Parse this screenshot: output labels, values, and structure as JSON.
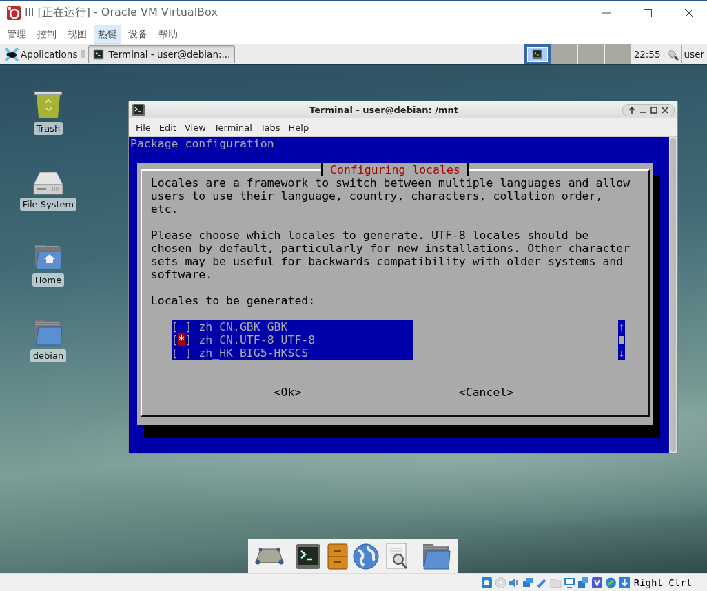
{
  "vbox_window": {
    "title": "lll [正在运行] - Oracle VM VirtualBox"
  },
  "vbox_menu": [
    {
      "label": "管理",
      "selected": false
    },
    {
      "label": "控制",
      "selected": false
    },
    {
      "label": "视图",
      "selected": false
    },
    {
      "label": "热键",
      "selected": true
    },
    {
      "label": "设备",
      "selected": false
    },
    {
      "label": "帮助",
      "selected": false
    }
  ],
  "panel": {
    "applications": "Applications",
    "tasks": [
      {
        "label": "Terminal - user@debian:...",
        "selected": true
      }
    ],
    "workspaces": [
      {
        "selected": true
      },
      {
        "selected": false
      },
      {
        "selected": false
      },
      {
        "selected": false
      }
    ],
    "clock": "22:55",
    "user": "user"
  },
  "desktop_icons": [
    {
      "kind": "trash",
      "label": "Trash"
    },
    {
      "kind": "drive",
      "label": "File System"
    },
    {
      "kind": "home",
      "label": "Home"
    },
    {
      "kind": "folder",
      "label": "debian"
    }
  ],
  "terminal_window": {
    "title": "Terminal - user@debian: /mnt",
    "menu": [
      "File",
      "Edit",
      "View",
      "Terminal",
      "Tabs",
      "Help"
    ],
    "screen": {
      "header": "Package configuration",
      "dialog": {
        "title": "Configuring locales",
        "paragraphs": [
          "Locales are a framework to switch between multiple languages and allow users to use their language, country, characters, collation order, etc.",
          "Please choose which locales to generate. UTF-8 locales should be chosen by default, particularly for new installations. Other character sets may be useful for backwards compatibility with older systems and software."
        ],
        "list_label": "Locales to be generated:",
        "items": [
          {
            "checkbox": "[ ]",
            "label": "zh_CN.GBK GBK",
            "checked": false
          },
          {
            "checkbox": "[*]",
            "label": "zh_CN.UTF-8 UTF-8",
            "checked": true
          },
          {
            "checkbox": "[ ]",
            "label": "zh_HK BIG5-HKSCS",
            "checked": false
          }
        ],
        "scroll_up": "↑",
        "scroll_down": "↓",
        "buttons": [
          "<Ok>",
          "<Cancel>"
        ]
      }
    }
  },
  "dock": [
    {
      "kind": "desktop"
    },
    {
      "kind": "separator"
    },
    {
      "kind": "terminal"
    },
    {
      "kind": "cabinet"
    },
    {
      "kind": "globe"
    },
    {
      "kind": "search"
    },
    {
      "kind": "separator"
    },
    {
      "kind": "folder"
    }
  ],
  "status_bar": {
    "host_key": "Right Ctrl"
  }
}
